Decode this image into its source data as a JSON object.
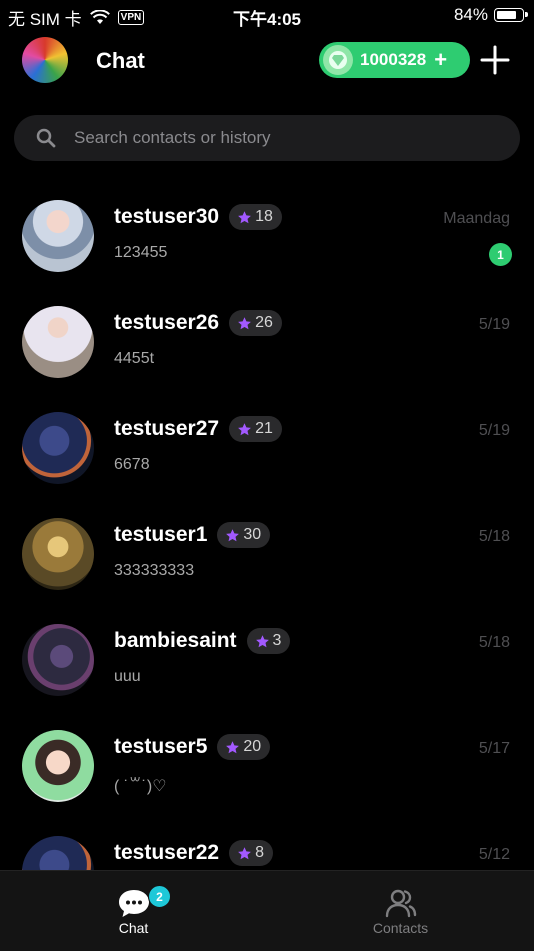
{
  "status_bar": {
    "carrier": "无 SIM 卡",
    "vpn": "VPN",
    "time": "下午4:05",
    "battery": "84%",
    "battery_level": 0.84
  },
  "header": {
    "title": "Chat",
    "coins": "1000328",
    "coins_plus": "+"
  },
  "search": {
    "placeholder": "Search contacts or history"
  },
  "chats": [
    {
      "name": "testuser30",
      "level": "18",
      "message": "123455",
      "time": "Maandag",
      "unread": "1"
    },
    {
      "name": "testuser26",
      "level": "26",
      "message": "4455t",
      "time": "5/19"
    },
    {
      "name": "testuser27",
      "level": "21",
      "message": "6678",
      "time": "5/19"
    },
    {
      "name": "testuser1",
      "level": "30",
      "message": "333333333",
      "time": "5/18"
    },
    {
      "name": "bambiesaint",
      "level": "3",
      "message": "uuu",
      "time": "5/18"
    },
    {
      "name": "testuser5",
      "level": "20",
      "message": "( ˙꒳˙)♡",
      "time": "5/17"
    },
    {
      "name": "testuser22",
      "level": "8",
      "message": "",
      "time": "5/12"
    }
  ],
  "tabs": {
    "chat_label": "Chat",
    "chat_badge": "2",
    "contacts_label": "Contacts"
  },
  "colors": {
    "accent_green": "#2ecc71",
    "star_purple": "#a259ff",
    "badge_cyan": "#1ec8d8"
  }
}
